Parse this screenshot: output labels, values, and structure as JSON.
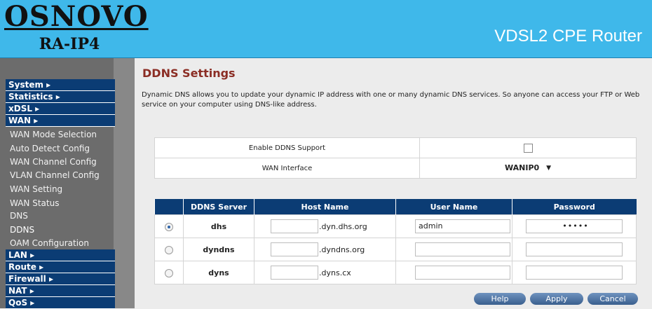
{
  "header": {
    "brand": "OSNOVO",
    "model": "RA-IP4",
    "product": "VDSL2 CPE Router"
  },
  "sidebar": {
    "sections": [
      {
        "label": "System ▸"
      },
      {
        "label": "Statistics ▸"
      },
      {
        "label": "xDSL ▸"
      },
      {
        "label": "WAN ▸"
      }
    ],
    "wan_items": [
      {
        "label": "WAN Mode Selection"
      },
      {
        "label": "Auto Detect Config"
      },
      {
        "label": "WAN Channel Config"
      },
      {
        "label": "VLAN Channel Config"
      },
      {
        "label": "WAN Setting"
      },
      {
        "label": "WAN Status"
      },
      {
        "label": "DNS"
      },
      {
        "label": "DDNS"
      },
      {
        "label": "OAM Configuration"
      }
    ],
    "sections_bottom": [
      {
        "label": "LAN ▸"
      },
      {
        "label": "Route ▸"
      },
      {
        "label": "Firewall ▸"
      },
      {
        "label": "NAT ▸"
      },
      {
        "label": "QoS ▸"
      }
    ]
  },
  "main": {
    "title": "DDNS Settings",
    "description": "Dynamic DNS allows you to update your dynamic IP address with one or many dynamic DNS services. So anyone can access your FTP or Web service on your computer using DNS-like address.",
    "enable_label": "Enable DDNS Support",
    "enable_checked": false,
    "wan_interface_label": "WAN Interface",
    "wan_interface_value": "WANIP0",
    "columns": [
      "DDNS Server",
      "Host Name",
      "User Name",
      "Password"
    ],
    "rows": [
      {
        "selected": true,
        "server": "dhs",
        "host": "",
        "suffix": ".dyn.dhs.org",
        "user": "admin",
        "password": "•••••"
      },
      {
        "selected": false,
        "server": "dyndns",
        "host": "",
        "suffix": ".dyndns.org",
        "user": "",
        "password": ""
      },
      {
        "selected": false,
        "server": "dyns",
        "host": "",
        "suffix": ".dyns.cx",
        "user": "",
        "password": ""
      }
    ],
    "buttons": {
      "help": "Help",
      "apply": "Apply",
      "cancel": "Cancel"
    }
  }
}
